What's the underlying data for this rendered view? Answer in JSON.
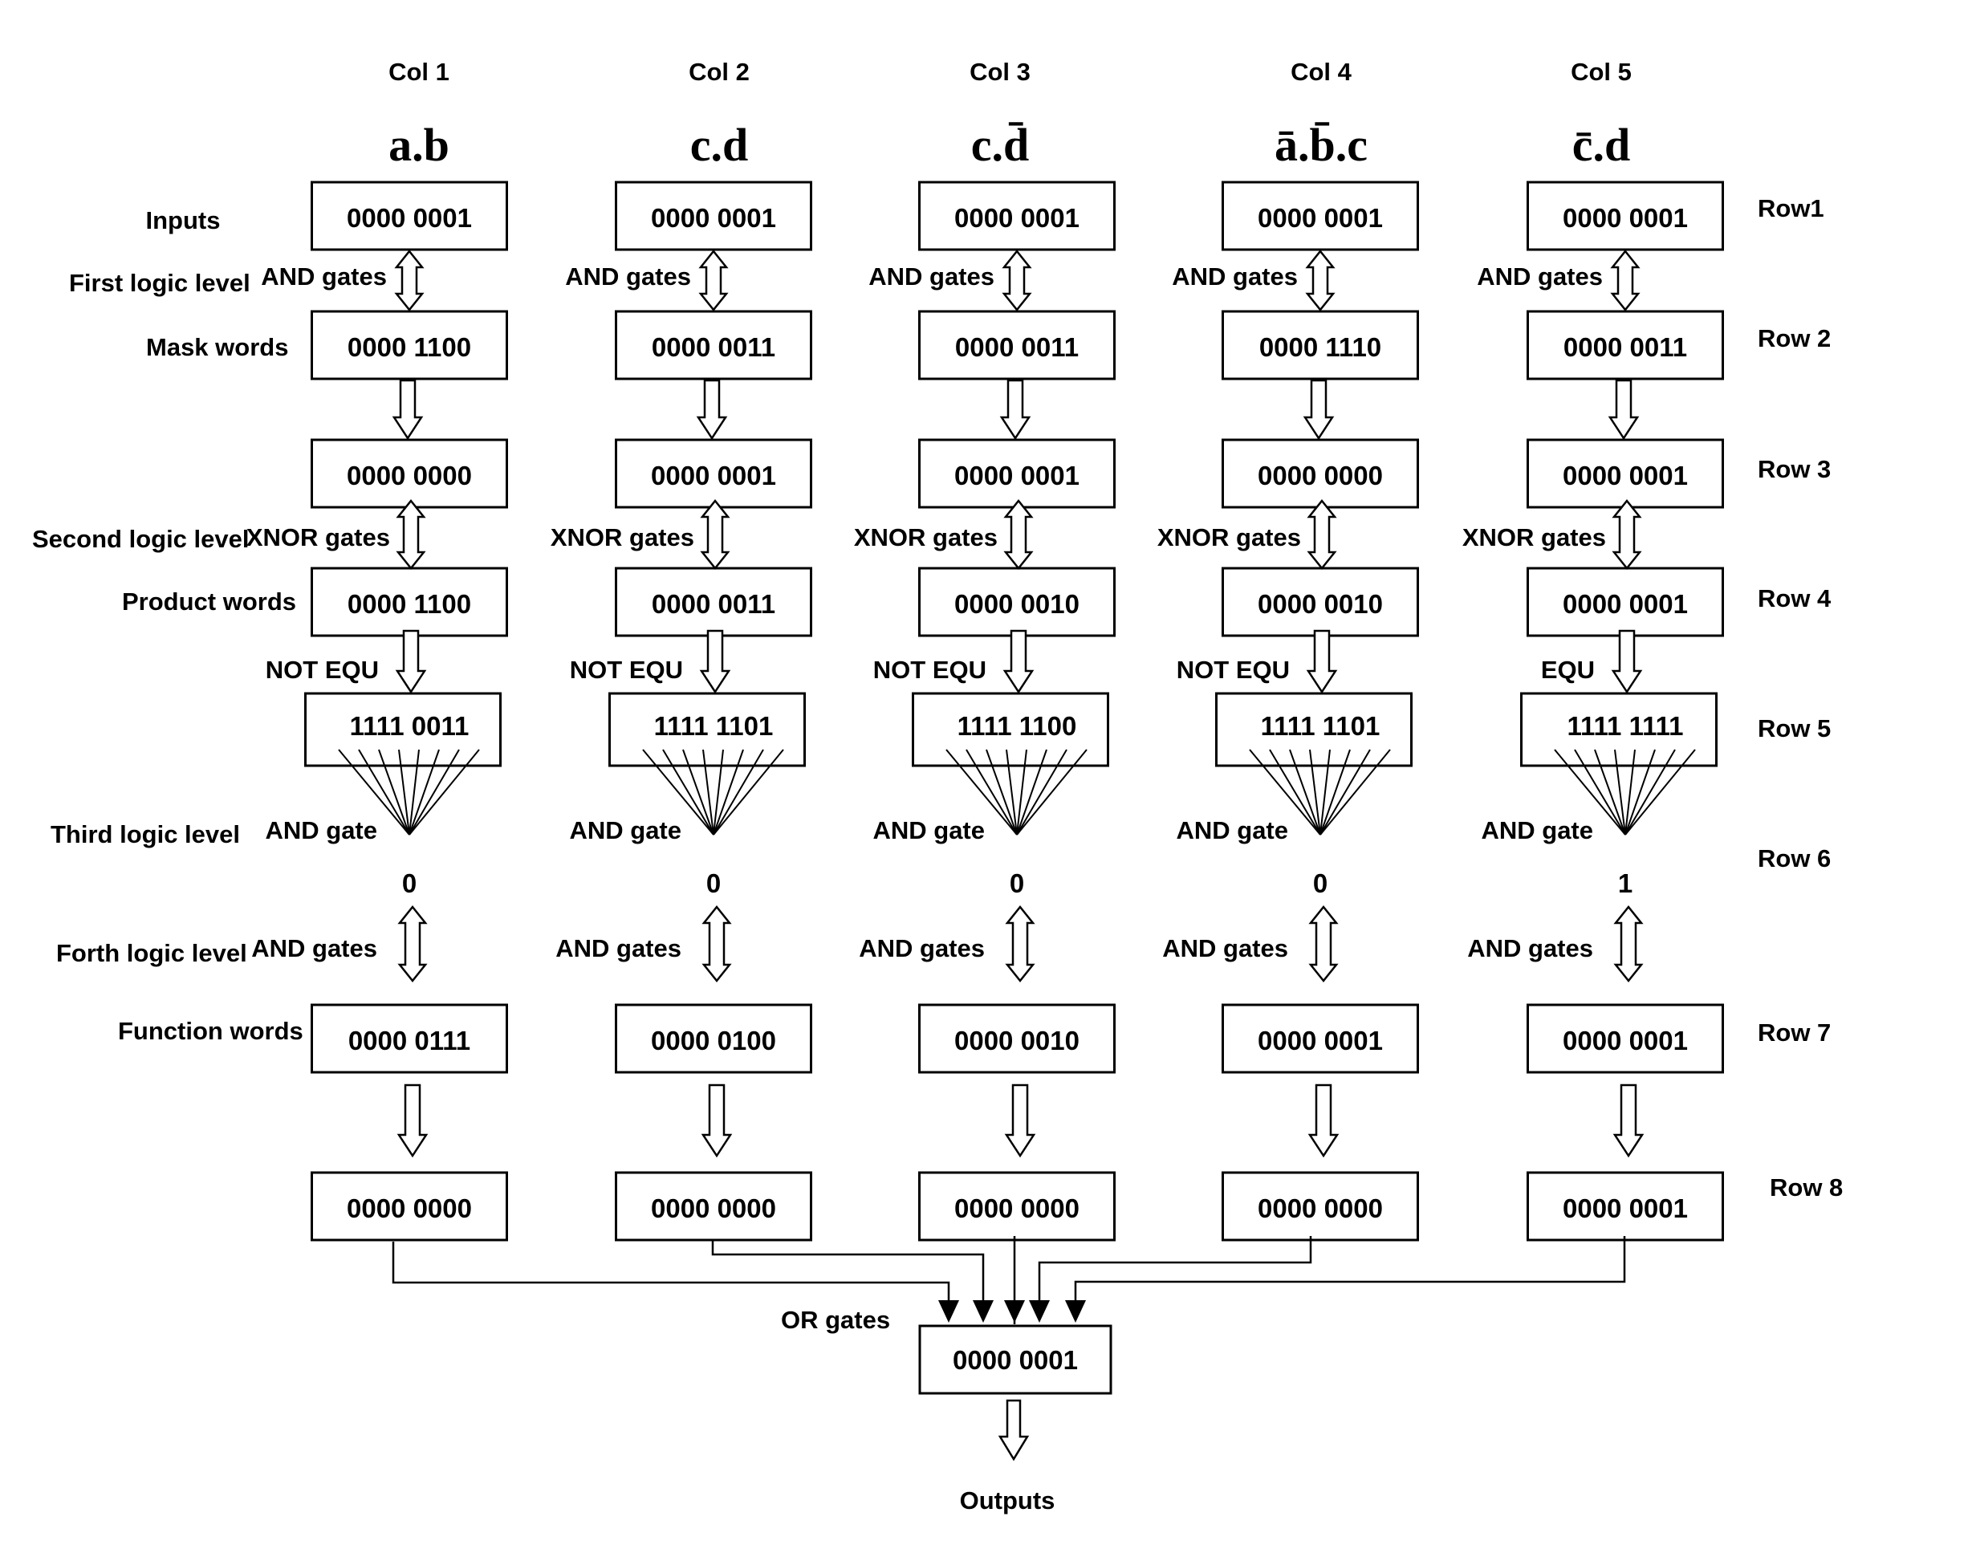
{
  "columns": [
    {
      "col_label": "Col 1",
      "term": "a.b",
      "first_gate": "AND gates",
      "second_gate": "XNOR gates",
      "compare_op": "NOT EQU",
      "third_gate": "AND gate",
      "fourth_gate": "AND gates",
      "rows": {
        "row1": "0000 0001",
        "row2": "0000 1100",
        "row3": "0000 0000",
        "row4": "0000 1100",
        "row5": "1111 0011",
        "row6": "0",
        "row7": "0000 0111",
        "row8": "0000 0000"
      }
    },
    {
      "col_label": "Col 2",
      "term": "c.d",
      "first_gate": "AND gates",
      "second_gate": "XNOR gates",
      "compare_op": "NOT EQU",
      "third_gate": "AND gate",
      "fourth_gate": "AND gates",
      "rows": {
        "row1": "0000 0001",
        "row2": "0000 0011",
        "row3": "0000 0001",
        "row4": "0000 0011",
        "row5": "1111 1101",
        "row6": "0",
        "row7": "0000 0100",
        "row8": "0000 0000"
      }
    },
    {
      "col_label": "Col 3",
      "term": "c.d̄",
      "first_gate": "AND gates",
      "second_gate": "XNOR gates",
      "compare_op": "NOT EQU",
      "third_gate": "AND gate",
      "fourth_gate": "AND gates",
      "rows": {
        "row1": "0000 0001",
        "row2": "0000 0011",
        "row3": "0000 0001",
        "row4": "0000 0010",
        "row5": "1111 1100",
        "row6": "0",
        "row7": "0000 0010",
        "row8": "0000 0000"
      }
    },
    {
      "col_label": "Col 4",
      "term": "ā.b̄.c",
      "first_gate": "AND gates",
      "second_gate": "XNOR gates",
      "compare_op": "NOT EQU",
      "third_gate": "AND gate",
      "fourth_gate": "AND gates",
      "rows": {
        "row1": "0000 0001",
        "row2": "0000 1110",
        "row3": "0000 0000",
        "row4": "0000 0010",
        "row5": "1111 1101",
        "row6": "0",
        "row7": "0000 0001",
        "row8": "0000 0000"
      }
    },
    {
      "col_label": "Col 5",
      "term": "c̄.d",
      "first_gate": "AND gates",
      "second_gate": "XNOR gates",
      "compare_op": "EQU",
      "third_gate": "AND gate",
      "fourth_gate": "AND gates",
      "rows": {
        "row1": "0000 0001",
        "row2": "0000 0011",
        "row3": "0000 0001",
        "row4": "0000 0001",
        "row5": "1111 1111",
        "row6": "1",
        "row7": "0000 0001",
        "row8": "0000 0001"
      }
    }
  ],
  "stage_labels": {
    "inputs": "Inputs",
    "first_logic_level": "First logic level",
    "mask_words": "Mask words",
    "second_logic_level": "Second logic level",
    "product_words": "Product words",
    "third_logic_level": "Third logic level",
    "forth_logic_level": "Forth logic level",
    "function_words": "Function words"
  },
  "row_labels": [
    "Row1",
    "Row 2",
    "Row 3",
    "Row 4",
    "Row 5",
    "Row 6",
    "Row 7",
    "Row 8"
  ],
  "output_stage": {
    "gate_label": "OR gates",
    "value": "0000 0001",
    "outputs_label": "Outputs"
  }
}
